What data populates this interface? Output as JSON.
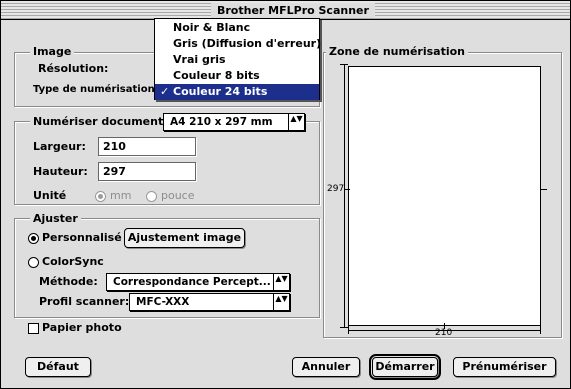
{
  "window": {
    "title": "Brother MFLPro Scanner"
  },
  "image_group": {
    "label": "Image",
    "resolution_label": "Résolution:",
    "scan_type_label": "Type de numérisation:",
    "scan_type_menu": {
      "items": [
        "Noir & Blanc",
        "Gris (Diffusion d'erreur)",
        "Vrai gris",
        "Couleur 8 bits",
        "Couleur 24 bits"
      ],
      "selected": "Couleur 24 bits",
      "check_glyph": "✓"
    }
  },
  "document_group": {
    "label": "Numériser document",
    "size_value": "A4 210 x 297 mm",
    "width_label": "Largeur:",
    "width_value": "210",
    "height_label": "Hauteur:",
    "height_value": "297",
    "unit_label": "Unité",
    "unit_options": [
      "mm",
      "pouce"
    ],
    "unit_selected": "mm"
  },
  "adjust_group": {
    "label": "Ajuster",
    "custom_label": "Personnalisé",
    "adjust_button": "Ajustement image",
    "colorsync_label": "ColorSync",
    "method_label": "Méthode:",
    "method_value": "Correspondance Percept...",
    "profile_label": "Profil scanner:",
    "profile_value": "MFC-XXX",
    "selected_mode": "Personnalisé"
  },
  "photo_paper": {
    "label": "Papier photo",
    "checked": false
  },
  "scan_area": {
    "label": "Zone de numérisation",
    "height_tick": "297",
    "width_tick": "210"
  },
  "buttons": {
    "default": "Défaut",
    "cancel": "Annuler",
    "start": "Démarrer",
    "prescan": "Prénumériser"
  },
  "popup_arrows": "▲▼"
}
